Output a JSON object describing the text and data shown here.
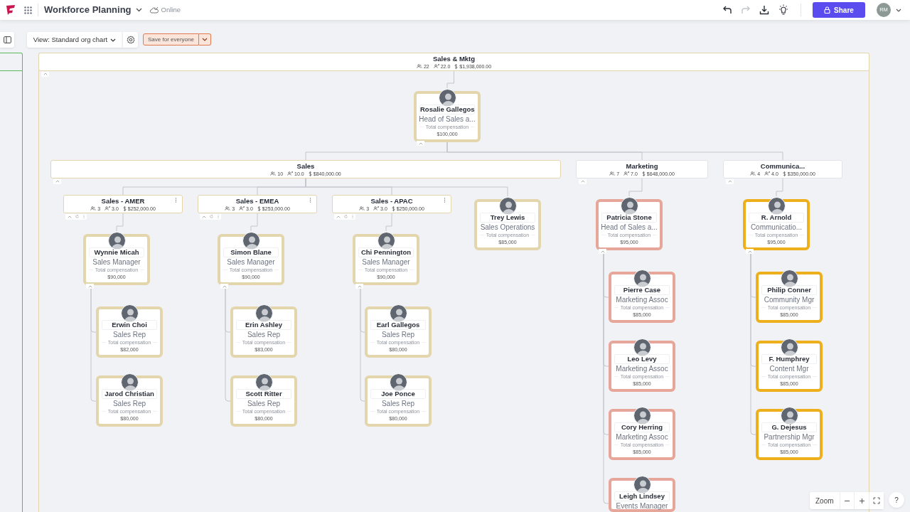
{
  "topbar": {
    "app_title": "Workforce Planning",
    "status": "Online",
    "history": [
      {
        "kind": "undo",
        "disabled": false
      },
      {
        "kind": "redo",
        "disabled": true
      }
    ],
    "share_label": "Share",
    "user_initials": "RM"
  },
  "toolbar": {
    "view_label": "View: Standard org chart",
    "save_label": "Save for everyone"
  },
  "org": {
    "kind": "department",
    "name": "Sales & Mktg",
    "color": "#e3d6ad",
    "people": "22",
    "fte": "22.0",
    "budget": "$1,938,000.00",
    "expanded": true,
    "children": [
      {
        "kind": "person",
        "name": "Rosalie Gallegos",
        "title": "Head of Sales a...",
        "comp_label": "Total compensation",
        "comp": "$100,000",
        "color": "#e3d6ad",
        "expanded": true,
        "children": [
          {
            "kind": "department",
            "name": "Sales",
            "color": "#e3d6ad",
            "people": "10",
            "fte": "10.0",
            "budget": "$840,000.00",
            "expanded": true,
            "children": [
              {
                "kind": "team",
                "name": "Sales - AMER",
                "color": "#e3d6ad",
                "people": "3",
                "fte": "3.0",
                "budget": "$252,000.00",
                "children": [
                  {
                    "kind": "person",
                    "name": "Wynnie Micah",
                    "title": "Sales Manager",
                    "comp_label": "Total compensation",
                    "comp": "$90,000",
                    "color": "#e3d6ad",
                    "expanded": true,
                    "children": [
                      {
                        "kind": "person",
                        "name": "Erwin Choi",
                        "title": "Sales Rep",
                        "comp_label": "Total compensation",
                        "comp": "$82,000",
                        "color": "#e3d6ad"
                      },
                      {
                        "kind": "person",
                        "name": "Jarod Christian",
                        "title": "Sales Rep",
                        "comp_label": "Total compensation",
                        "comp": "$80,000",
                        "color": "#e3d6ad"
                      }
                    ]
                  }
                ]
              },
              {
                "kind": "team",
                "name": "Sales - EMEA",
                "color": "#e3d6ad",
                "people": "3",
                "fte": "3.0",
                "budget": "$253,000.00",
                "children": [
                  {
                    "kind": "person",
                    "name": "Simon Blane",
                    "title": "Sales Manager",
                    "comp_label": "Total compensation",
                    "comp": "$90,000",
                    "color": "#e3d6ad",
                    "expanded": true,
                    "children": [
                      {
                        "kind": "person",
                        "name": "Erin Ashley",
                        "title": "Sales Rep",
                        "comp_label": "Total compensation",
                        "comp": "$83,000",
                        "color": "#e3d6ad"
                      },
                      {
                        "kind": "person",
                        "name": "Scott Ritter",
                        "title": "Sales Rep",
                        "comp_label": "Total compensation",
                        "comp": "$80,000",
                        "color": "#e3d6ad"
                      }
                    ]
                  }
                ]
              },
              {
                "kind": "team",
                "name": "Sales - APAC",
                "color": "#e3d6ad",
                "people": "3",
                "fte": "3.0",
                "budget": "$250,000.00",
                "children": [
                  {
                    "kind": "person",
                    "name": "Chi Pennington",
                    "title": "Sales Manager",
                    "comp_label": "Total compensation",
                    "comp": "$90,000",
                    "color": "#e3d6ad",
                    "expanded": true,
                    "children": [
                      {
                        "kind": "person",
                        "name": "Earl Gallegos",
                        "title": "Sales Rep",
                        "comp_label": "Total compensation",
                        "comp": "$80,000",
                        "color": "#e3d6ad"
                      },
                      {
                        "kind": "person",
                        "name": "Joe Ponce",
                        "title": "Sales Rep",
                        "comp_label": "Total compensation",
                        "comp": "$80,000",
                        "color": "#e3d6ad"
                      }
                    ]
                  }
                ]
              },
              {
                "kind": "person",
                "name": "Trey Lewis",
                "title": "Sales Operations",
                "comp_label": "Total compensation",
                "comp": "$85,000",
                "color": "#e3d6ad"
              }
            ]
          },
          {
            "kind": "department",
            "name": "Marketing",
            "color": "#e2e3e8",
            "people": "7",
            "fte": "7.0",
            "budget": "$648,000.00",
            "expanded": true,
            "children": [
              {
                "kind": "person",
                "name": "Patricia Stone",
                "title": "Head of Sales a...",
                "comp_label": "Total compensation",
                "comp": "$95,000",
                "color": "#e6a699",
                "expanded": true,
                "children": [
                  {
                    "kind": "person",
                    "name": "Pierre Case",
                    "title": "Marketing Assoc",
                    "comp_label": "Total compensation",
                    "comp": "$85,000",
                    "color": "#e6a699"
                  },
                  {
                    "kind": "person",
                    "name": "Leo Levy",
                    "title": "Marketing Assoc",
                    "comp_label": "Total compensation",
                    "comp": "$85,000",
                    "color": "#e6a699"
                  },
                  {
                    "kind": "person",
                    "name": "Cory Herring",
                    "title": "Marketing Assoc",
                    "comp_label": "Total compensation",
                    "comp": "$85,000",
                    "color": "#e6a699"
                  },
                  {
                    "kind": "person",
                    "name": "Leigh Lindsey",
                    "title": "Events Manager",
                    "color": "#e6a699"
                  }
                ]
              }
            ]
          },
          {
            "kind": "department",
            "name": "Communica...",
            "color": "#e2e3e8",
            "people": "4",
            "fte": "4.0",
            "budget": "$350,000.00",
            "expanded": true,
            "children": [
              {
                "kind": "person",
                "name": "R. Arnold",
                "title": "Communicatio...",
                "comp_label": "Total compensation",
                "comp": "$95,000",
                "color": "#eeaf1c",
                "expanded": true,
                "children": [
                  {
                    "kind": "person",
                    "name": "Philip Conner",
                    "title": "Community Mgr",
                    "comp_label": "Total compensation",
                    "comp": "$85,000",
                    "color": "#eeaf1c"
                  },
                  {
                    "kind": "person",
                    "name": "F. Humphrey",
                    "title": "Content Mgr",
                    "comp_label": "Total compensation",
                    "comp": "$85,000",
                    "color": "#eeaf1c"
                  },
                  {
                    "kind": "person",
                    "name": "G. Dejesus",
                    "title": "Partnership Mgr",
                    "comp_label": "Total compensation",
                    "comp": "$85,000",
                    "color": "#eeaf1c"
                  }
                ]
              }
            ]
          }
        ]
      }
    ]
  },
  "zoom": {
    "label": "Zoom",
    "help": "?"
  }
}
